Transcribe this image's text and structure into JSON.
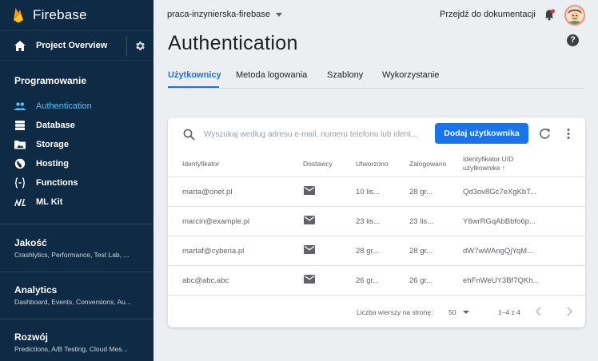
{
  "sidebar": {
    "brand": "Firebase",
    "overview_label": "Project Overview",
    "section_title": "Programowanie",
    "items": [
      {
        "label": "Authentication",
        "icon": "people-icon"
      },
      {
        "label": "Database",
        "icon": "database-icon"
      },
      {
        "label": "Storage",
        "icon": "folder-icon"
      },
      {
        "label": "Hosting",
        "icon": "globe-icon"
      },
      {
        "label": "Functions",
        "icon": "functions-icon"
      },
      {
        "label": "ML Kit",
        "icon": "ml-kit-icon"
      }
    ],
    "groups": [
      {
        "title": "Jakość",
        "subtitle": "Crashlytics, Performance, Test Lab, ..."
      },
      {
        "title": "Analytics",
        "subtitle": "Dashboard, Events, Conversions, Au..."
      },
      {
        "title": "Rozwój",
        "subtitle": "Predictions, A/B Testing, Cloud Mes..."
      }
    ]
  },
  "header": {
    "project_name": "praca-inzynierska-firebase",
    "docs_link": "Przejdź do dokumentacji",
    "page_title": "Authentication",
    "help": "?"
  },
  "tabs": [
    {
      "label": "Użytkownicy",
      "active": true
    },
    {
      "label": "Metoda logowania",
      "active": false
    },
    {
      "label": "Szablony",
      "active": false
    },
    {
      "label": "Wykorzystanie",
      "active": false
    }
  ],
  "users": {
    "search_placeholder": "Wyszukaj według adresu e-mail, numeru telefonu lub ident...",
    "add_button": "Dodaj użytkownika",
    "columns": {
      "identifier": "Identyfikator",
      "providers": "Dostawcy",
      "created": "Utworzono",
      "signed_in": "Zalogowano",
      "uid_line1": "Identyfikator UID",
      "uid_line2": "użytkownika",
      "sort_arrow": "↑"
    },
    "rows": [
      {
        "id": "marta@onet.pl",
        "created": "10 lis...",
        "signed_in": "28 gr...",
        "uid": "Qd3ov8Gc7eXgKbT..."
      },
      {
        "id": "marcin@example.pl",
        "created": "23 lis...",
        "signed_in": "23 lis...",
        "uid": "Y6wrRGqAbBbfo6p..."
      },
      {
        "id": "martaf@cyberia.pl",
        "created": "28 gr...",
        "signed_in": "28 gr...",
        "uid": "dW7wWAngQjYqM..."
      },
      {
        "id": "abc@abc.abc",
        "created": "26 gr...",
        "signed_in": "26 gr...",
        "uid": "ehFnWeUY3Bf7QKh..."
      }
    ],
    "footer": {
      "rows_per_page_label": "Liczba wierszy na stronę:",
      "rows_per_page": "50",
      "range": "1–4 z 4"
    }
  },
  "colors": {
    "sidebar_bg": "#0f2a45",
    "accent": "#1a73e8",
    "active_nav": "#4fc3f7"
  }
}
